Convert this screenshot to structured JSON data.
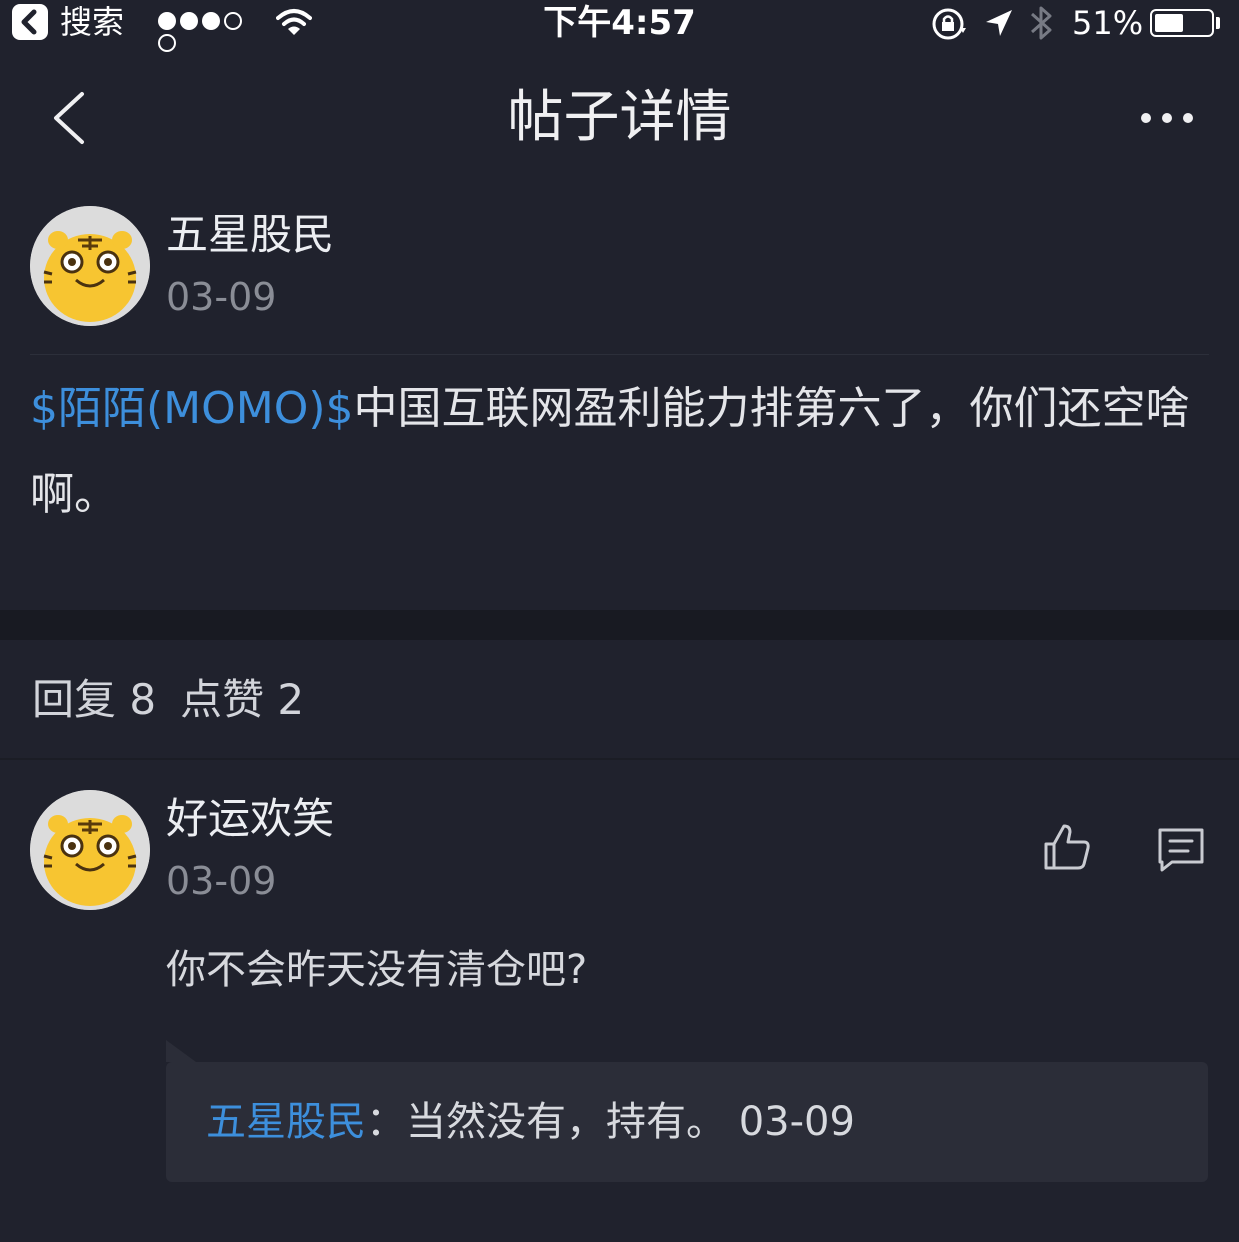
{
  "status_bar": {
    "back_app": "搜索",
    "time": "下午4:57",
    "battery": "51%",
    "battery_level": 0.51
  },
  "nav": {
    "title": "帖子详情"
  },
  "post": {
    "author": "五星股民",
    "date": "03-09",
    "stock_tag": "$陌陌(MOMO)$",
    "text": "中国互联网盈利能力排第六了，你们还空啥啊。"
  },
  "stats": {
    "replies_label": "回复 8",
    "likes_label": "点赞 2"
  },
  "reply": {
    "author": "好运欢笑",
    "date": "03-09",
    "text": "你不会昨天没有清仓吧?",
    "quote": {
      "name": "五星股民",
      "separator": "：",
      "text": "当然没有，持有。",
      "date": "03-09"
    }
  },
  "colors": {
    "background": "#20222d",
    "link": "#3d8fdc",
    "avatar_yellow": "#f7c531"
  }
}
